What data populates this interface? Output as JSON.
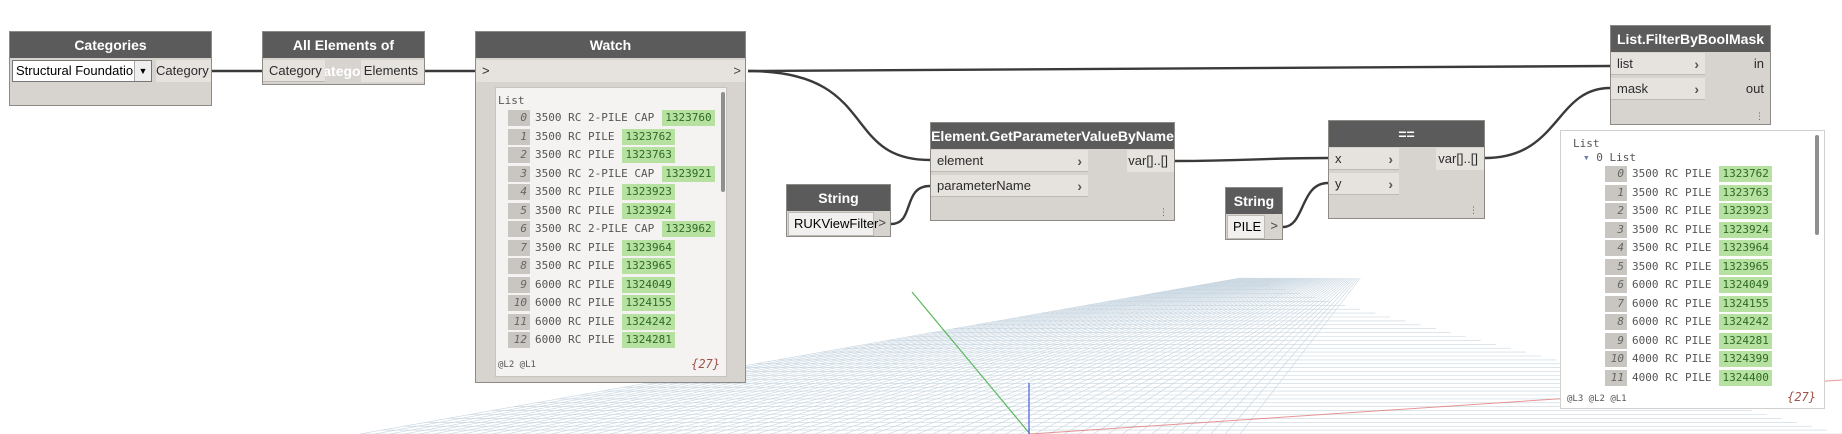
{
  "categories_node": {
    "title": "Categories",
    "selected": "Structural Foundations",
    "output": "Category"
  },
  "all_elements_node": {
    "title": "All Elements of Category",
    "input": "Category",
    "output": "Elements"
  },
  "watch_node": {
    "title": "Watch",
    "in_arrow": ">",
    "out_arrow": ">",
    "list_label": "List",
    "items": [
      {
        "idx": "0",
        "name": "3500 RC 2-PILE CAP",
        "id": "1323760"
      },
      {
        "idx": "1",
        "name": "3500 RC PILE",
        "id": "1323762"
      },
      {
        "idx": "2",
        "name": "3500 RC PILE",
        "id": "1323763"
      },
      {
        "idx": "3",
        "name": "3500 RC 2-PILE CAP",
        "id": "1323921"
      },
      {
        "idx": "4",
        "name": "3500 RC PILE",
        "id": "1323923"
      },
      {
        "idx": "5",
        "name": "3500 RC PILE",
        "id": "1323924"
      },
      {
        "idx": "6",
        "name": "3500 RC 2-PILE CAP",
        "id": "1323962"
      },
      {
        "idx": "7",
        "name": "3500 RC PILE",
        "id": "1323964"
      },
      {
        "idx": "8",
        "name": "3500 RC PILE",
        "id": "1323965"
      },
      {
        "idx": "9",
        "name": "6000 RC PILE",
        "id": "1324049"
      },
      {
        "idx": "10",
        "name": "6000 RC PILE",
        "id": "1324155"
      },
      {
        "idx": "11",
        "name": "6000 RC PILE",
        "id": "1324242"
      },
      {
        "idx": "12",
        "name": "6000 RC PILE",
        "id": "1324281"
      }
    ],
    "levels": "@L2 @L1",
    "count": "{27}"
  },
  "getparam_node": {
    "title": "Element.GetParameterValueByName",
    "input1": "element",
    "input2": "parameterName",
    "output": "var[]..[]"
  },
  "string1_node": {
    "title": "String",
    "value": "RUKViewFilter",
    "out_arrow": ">"
  },
  "string2_node": {
    "title": "String",
    "value": "PILE",
    "out_arrow": ">"
  },
  "equals_node": {
    "title": "==",
    "input1": "x",
    "input2": "y",
    "output": "var[]..[]"
  },
  "filter_node": {
    "title": "List.FilterByBoolMask",
    "input1": "list",
    "input2": "mask",
    "output1": "in",
    "output2": "out"
  },
  "filter_preview": {
    "list_label": "List",
    "sub_label": "0 List",
    "items": [
      {
        "idx": "0",
        "name": "3500 RC PILE",
        "id": "1323762"
      },
      {
        "idx": "1",
        "name": "3500 RC PILE",
        "id": "1323763"
      },
      {
        "idx": "2",
        "name": "3500 RC PILE",
        "id": "1323923"
      },
      {
        "idx": "3",
        "name": "3500 RC PILE",
        "id": "1323924"
      },
      {
        "idx": "4",
        "name": "3500 RC PILE",
        "id": "1323964"
      },
      {
        "idx": "5",
        "name": "3500 RC PILE",
        "id": "1323965"
      },
      {
        "idx": "6",
        "name": "6000 RC PILE",
        "id": "1324049"
      },
      {
        "idx": "7",
        "name": "6000 RC PILE",
        "id": "1324155"
      },
      {
        "idx": "8",
        "name": "6000 RC PILE",
        "id": "1324242"
      },
      {
        "idx": "9",
        "name": "6000 RC PILE",
        "id": "1324281"
      },
      {
        "idx": "10",
        "name": "4000 RC PILE",
        "id": "1324399"
      },
      {
        "idx": "11",
        "name": "4000 RC PILE",
        "id": "1324400"
      }
    ],
    "levels": "@L3 @L2 @L1",
    "count": "{27}"
  },
  "colors": {
    "header": "#5b5b5b",
    "node_body": "#d7d3cf",
    "id_highlight": "#b7e1a1",
    "wire": "#3a3a3a",
    "grid": "#c4d3de"
  },
  "icons": [
    "dropdown-arrow-icon",
    "port-chevron-icon",
    "collapse-triangle-icon"
  ]
}
